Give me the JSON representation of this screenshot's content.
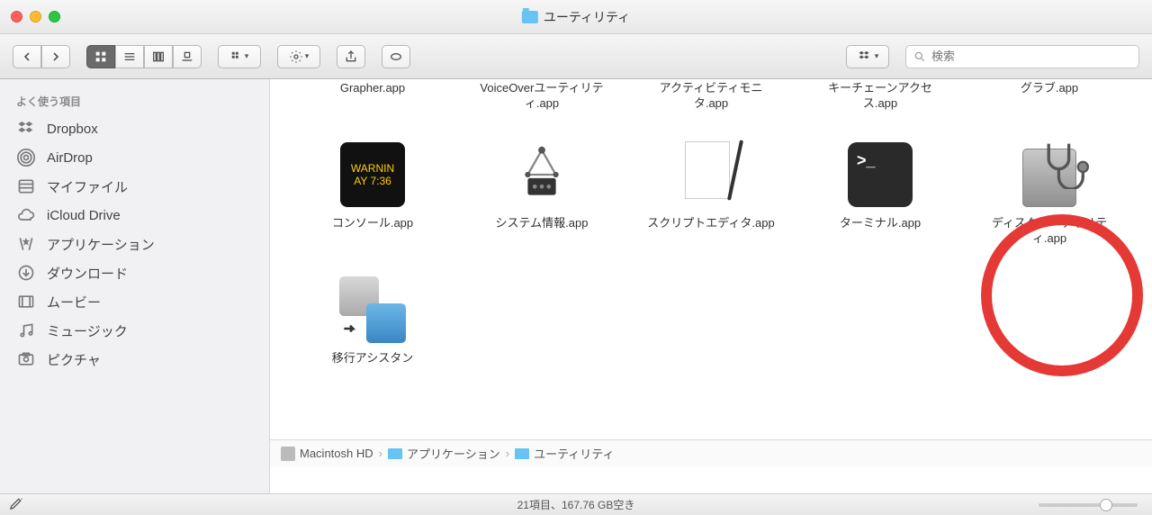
{
  "window": {
    "title": "ユーティリティ"
  },
  "toolbar": {
    "search_placeholder": "検索"
  },
  "sidebar": {
    "favorites_label": "よく使う項目",
    "items": [
      {
        "label": "Dropbox",
        "icon": "dropbox-icon"
      },
      {
        "label": "AirDrop",
        "icon": "airdrop-icon"
      },
      {
        "label": "マイファイル",
        "icon": "myfiles-icon"
      },
      {
        "label": "iCloud Drive",
        "icon": "icloud-icon"
      },
      {
        "label": "アプリケーション",
        "icon": "applications-icon"
      },
      {
        "label": "ダウンロード",
        "icon": "downloads-icon"
      },
      {
        "label": "ムービー",
        "icon": "movies-icon"
      },
      {
        "label": "ミュージック",
        "icon": "music-icon"
      },
      {
        "label": "ピクチャ",
        "icon": "pictures-icon"
      }
    ]
  },
  "apps_row1": [
    {
      "label": "Grapher.app"
    },
    {
      "label": "VoiceOverユーティリティ.app"
    },
    {
      "label": "アクティビティモニタ.app"
    },
    {
      "label": "キーチェーンアクセス.app"
    },
    {
      "label": "グラブ.app"
    }
  ],
  "apps_row2": [
    {
      "label": "コンソール.app",
      "icon": "console"
    },
    {
      "label": "システム情報.app",
      "icon": "sysinfo"
    },
    {
      "label": "スクリプトエディタ.app",
      "icon": "script"
    },
    {
      "label": "ターミナル.app",
      "icon": "terminal"
    },
    {
      "label": "ディスクユーティリティ.app",
      "icon": "disk"
    }
  ],
  "apps_row3": [
    {
      "label": "移行アシスタン",
      "icon": "migrate"
    }
  ],
  "console_text": {
    "l1": "WARNIN",
    "l2": "AY 7:36"
  },
  "terminal_text": ">_",
  "path": {
    "p1": "Macintosh HD",
    "p2": "アプリケーション",
    "p3": "ユーティリティ"
  },
  "status": "21項目、167.76 GB空き"
}
